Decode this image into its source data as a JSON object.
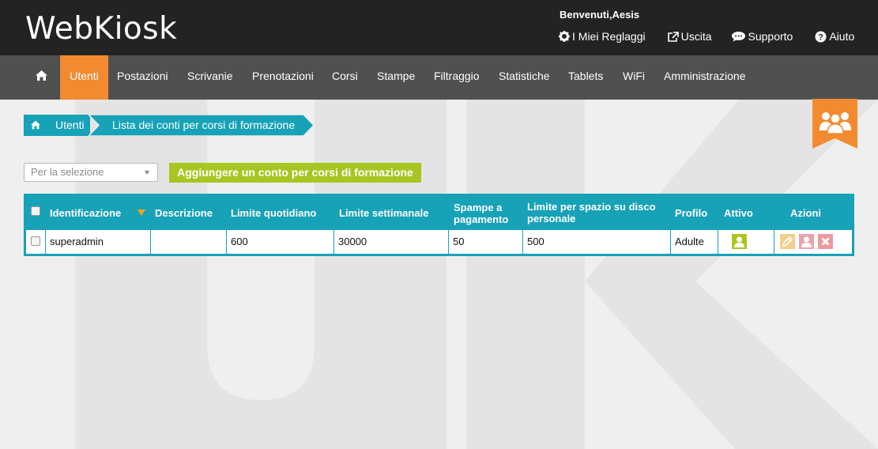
{
  "header": {
    "logo": "WebKiosk",
    "welcome": "Benvenuti,Aesis",
    "links": [
      {
        "label": "I Miei Reglaggi",
        "icon": "gear-icon"
      },
      {
        "label": "Uscita",
        "icon": "external-link-icon"
      },
      {
        "label": "Supporto",
        "icon": "chat-icon"
      },
      {
        "label": "Aiuto",
        "icon": "help-icon"
      }
    ]
  },
  "nav": {
    "items": [
      "Utenti",
      "Postazioni",
      "Scrivanie",
      "Prenotazioni",
      "Corsi",
      "Stampe",
      "Filtraggio",
      "Statistiche",
      "Tablets",
      "WiFi",
      "Amministrazione"
    ],
    "active": "Utenti",
    "accent": "#f28b30"
  },
  "breadcrumb": {
    "home_label": "Utenti",
    "current": "Lista dei conti per corsi di formazione"
  },
  "controls": {
    "select_value": "Per la selezione",
    "add_button": "Aggiungere un conto per corsi di formazione"
  },
  "table": {
    "headers": {
      "id": "Identificazione",
      "desc": "Descrizione",
      "daily": "Limite quotidiano",
      "weekly": "Limite settimanale",
      "paid_a": "Spampe a",
      "paid_b": "pagamento",
      "disk_a": "Limite per spazio su disco",
      "disk_b": "personale",
      "profile": "Profilo",
      "active": "Attivo",
      "actions": "Azioni"
    },
    "rows": [
      {
        "id": "superadmin",
        "desc": "",
        "daily": "600",
        "weekly": "30000",
        "paid": "50",
        "disk": "500",
        "profile": "Adulte"
      }
    ]
  },
  "colors": {
    "teal": "#17a2b8",
    "green": "#a8c623",
    "orange": "#f28b30",
    "header_bg": "#232323",
    "nav_bg": "#505050"
  }
}
